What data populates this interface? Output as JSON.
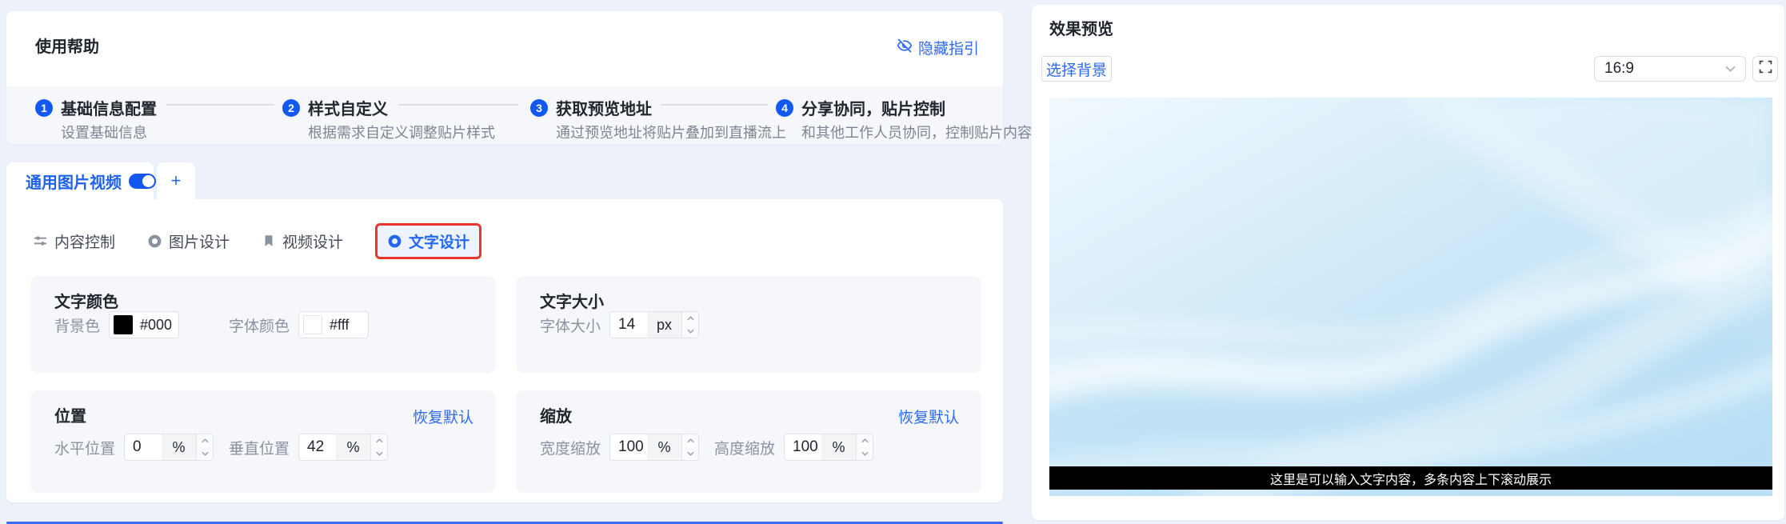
{
  "colors": {
    "accent": "#2468f2",
    "link_blue": "#2d6af0",
    "step_circle_blue": "#1159f1",
    "toggle_on_blue": "#1456f0",
    "highlight_red": "#e8362e",
    "panel_bg": "#f6f7fa",
    "page_bg": "#edf1fa",
    "overlay_bar_bg": "#000000",
    "overlay_text_color": "#ffffff"
  },
  "help": {
    "title": "使用帮助",
    "hide_guide_label": "隐藏指引",
    "steps": [
      {
        "num": "1",
        "title": "基础信息配置",
        "desc": "设置基础信息"
      },
      {
        "num": "2",
        "title": "样式自定义",
        "desc": "根据需求自定义调整贴片样式"
      },
      {
        "num": "3",
        "title": "获取预览地址",
        "desc": "通过预览地址将贴片叠加到直播流上"
      },
      {
        "num": "4",
        "title": "分享协同，贴片控制",
        "desc": "和其他工作人员协同，控制贴片内容"
      }
    ]
  },
  "source_tabs": {
    "active_label": "通用图片视频",
    "toggle_state": "on",
    "add_label": "+"
  },
  "design_tabs": {
    "items": [
      {
        "label": "内容控制",
        "icon": "sliders-icon"
      },
      {
        "label": "图片设计",
        "icon": "ring-icon"
      },
      {
        "label": "视频设计",
        "icon": "bookmark-icon"
      },
      {
        "label": "文字设计",
        "icon": "ring-icon"
      }
    ],
    "active_index": 3
  },
  "panels": {
    "text_color": {
      "title": "文字颜色",
      "fields": [
        {
          "label": "背景色",
          "value": "#000",
          "swatch": "#000000"
        },
        {
          "label": "字体颜色",
          "value": "#fff",
          "swatch": "#ffffff"
        }
      ]
    },
    "text_size": {
      "title": "文字大小",
      "field": {
        "label": "字体大小",
        "value": "14",
        "unit": "px"
      }
    },
    "position": {
      "title": "位置",
      "reset_label": "恢复默认",
      "fields": [
        {
          "label": "水平位置",
          "value": "0",
          "unit": "%"
        },
        {
          "label": "垂直位置",
          "value": "42",
          "unit": "%"
        }
      ]
    },
    "scale": {
      "title": "缩放",
      "reset_label": "恢复默认",
      "fields": [
        {
          "label": "宽度缩放",
          "value": "100",
          "unit": "%"
        },
        {
          "label": "高度缩放",
          "value": "100",
          "unit": "%"
        }
      ]
    }
  },
  "preview": {
    "title": "效果预览",
    "select_background_label": "选择背景",
    "aspect_ratio": "16:9",
    "overlay_text": "这里是可以输入文字内容，多条内容上下滚动展示"
  }
}
